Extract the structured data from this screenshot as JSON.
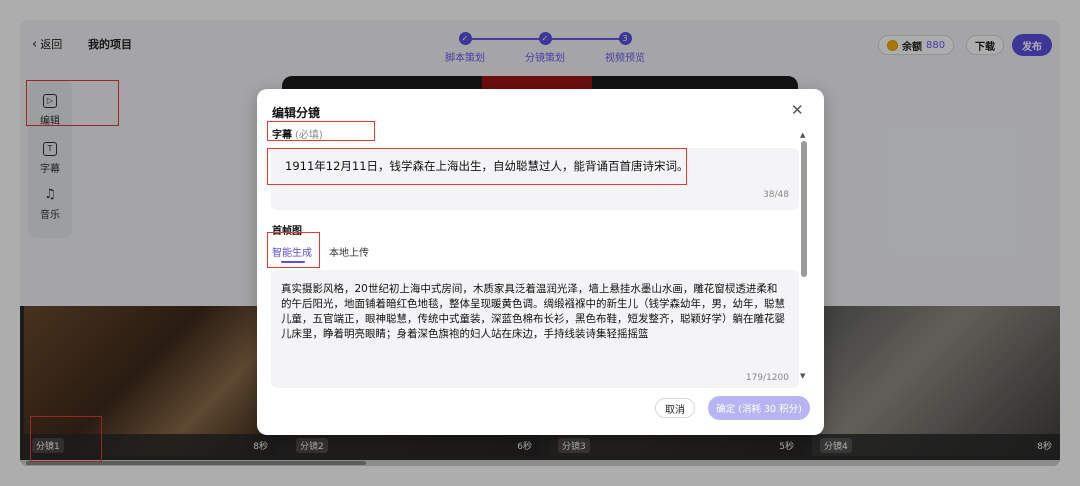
{
  "topbar": {
    "back_label": "返回",
    "project_title": "我的项目",
    "steps": [
      {
        "label": "脚本策划",
        "marker": "✓"
      },
      {
        "label": "分镜策划",
        "marker": "✓"
      },
      {
        "label": "视频预览",
        "marker": "3"
      }
    ],
    "balance_label": "余额",
    "balance_value": "880",
    "download_label": "下载",
    "publish_label": "发布"
  },
  "left_tools": [
    {
      "label": "编辑",
      "icon": "play-box-icon"
    },
    {
      "label": "字幕",
      "icon": "subtitle-icon"
    },
    {
      "label": "音乐",
      "icon": "music-note-icon"
    }
  ],
  "filmstrip": [
    {
      "name": "分镜1",
      "duration": "8秒"
    },
    {
      "name": "分镜2",
      "duration": "6秒"
    },
    {
      "name": "分镜3",
      "duration": "5秒"
    },
    {
      "name": "分镜4",
      "duration": "8秒"
    }
  ],
  "modal": {
    "title": "编辑分镜",
    "subtitle_label": "字幕",
    "subtitle_required": "(必填)",
    "subtitle_value": "1911年12月11日，钱学森在上海出生，自幼聪慧过人，能背诵百首唐诗宋词。",
    "subtitle_count": "38/48",
    "first_frame_label": "首帧图",
    "tab_smart": "智能生成",
    "tab_local": "本地上传",
    "prompt_value": "真实摄影风格，20世纪初上海中式房间，木质家具泛着温润光泽，墙上悬挂水墨山水画，雕花窗棂透进柔和的午后阳光，地面铺着暗红色地毯，整体呈现暖黄色调。绸缎襁褓中的新生儿（钱学森幼年，男，幼年，聪慧儿童，五官端正，眼神聪慧，传统中式童装，深蓝色棉布长衫，黑色布鞋，短发整齐，聪颖好学）躺在雕花婴儿床里，睁着明亮眼睛；身着深色旗袍的妇人站在床边，手持线装诗集轻摇摇篮",
    "prompt_count": "179/1200",
    "cancel_label": "取消",
    "confirm_label": "确定 (消耗 30 积分)"
  },
  "colors": {
    "accent": "#5b4fe0",
    "highlight_box": "#e53935"
  }
}
